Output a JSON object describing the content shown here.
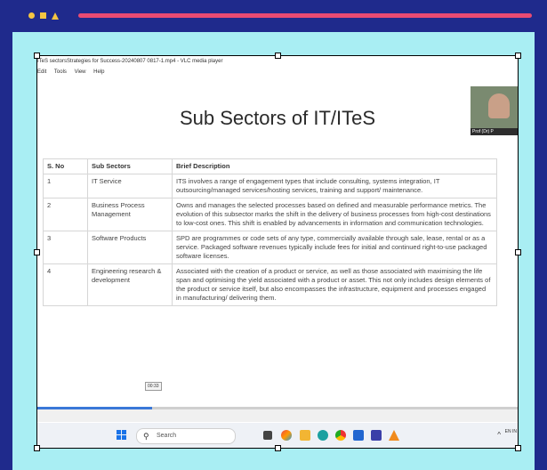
{
  "vlc": {
    "window_title": "ITeS sectorsStrategies for Success-20240807 0817-1.mp4 - VLC media player",
    "menu": [
      "Edit",
      "Tools",
      "View",
      "Help"
    ],
    "timestamp": "00:33"
  },
  "slide": {
    "title": "Sub Sectors of IT/ITeS",
    "presenter_label": "Prof (Dr) P",
    "table": {
      "headers": [
        "S. No",
        "Sub Sectors",
        "Brief Description"
      ],
      "rows": [
        {
          "no": "1",
          "sector": "IT Service",
          "desc": "ITS involves a range of engagement types that include consulting, systems integration, IT outsourcing/managed services/hosting services, training and support/ maintenance."
        },
        {
          "no": "2",
          "sector": "Business Process Management",
          "desc": "Owns and manages the selected processes based on defined and measurable performance metrics. The evolution of this subsector marks the shift in the delivery of business processes from high-cost destinations to low-cost ones. This shift is enabled by advancements in information and communication technologies."
        },
        {
          "no": "3",
          "sector": "Software Products",
          "desc": "SPD are programmes or code sets of any type, commercially available through sale, lease, rental or as a service. Packaged software revenues typically include fees for initial and continued right-to-use packaged software licenses."
        },
        {
          "no": "4",
          "sector": "Engineering research & development",
          "desc": "Associated with the creation of a product or service, as well as those associated with maximising the life span and optimising the yield associated with a product or asset. This not only includes design elements of the product or service itself, but also encompasses the infrastructure, equipment and processes engaged in manufacturing/ delivering them."
        }
      ]
    }
  },
  "taskbar": {
    "search_placeholder": "Search",
    "tray_caret": "^",
    "tray_lang": "EN IN"
  },
  "colors": {
    "frame": "#1f2a8c",
    "background": "#a9eef3",
    "accent_line": "#e94b73",
    "seek_fill": "#3a78d8"
  }
}
